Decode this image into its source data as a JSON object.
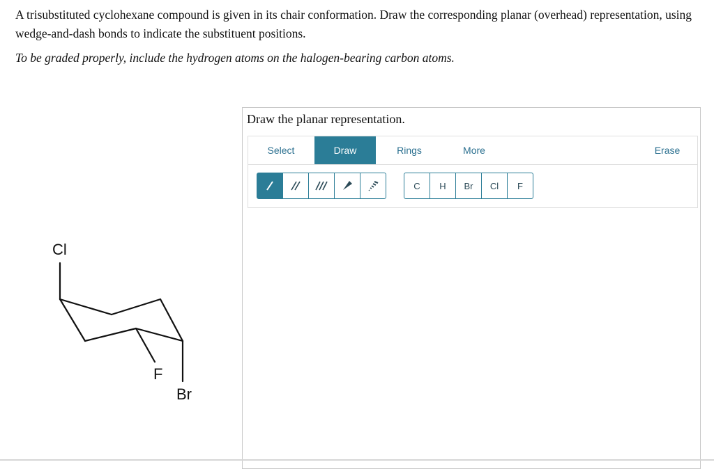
{
  "question": {
    "text": "A trisubstituted cyclohexane compound is given in its chair conformation. Draw the corresponding planar (overhead) representation, using wedge-and-dash bonds to indicate the substituent positions.",
    "note": "To be graded properly, include the hydrogen atoms on the halogen-bearing carbon atoms."
  },
  "molecule": {
    "labels": {
      "cl": "Cl",
      "f": "F",
      "br": "Br"
    }
  },
  "panel": {
    "title": "Draw the planar representation."
  },
  "menu": {
    "select": "Select",
    "draw": "Draw",
    "rings": "Rings",
    "more": "More",
    "erase": "Erase"
  },
  "bond_tools": [
    "single-bond",
    "double-bond",
    "triple-bond",
    "wedge-bond",
    "dash-bond"
  ],
  "atoms": [
    "C",
    "H",
    "Br",
    "Cl",
    "F"
  ],
  "colors": {
    "accent": "#2b7d97",
    "menu_text": "#2a6f8f"
  }
}
